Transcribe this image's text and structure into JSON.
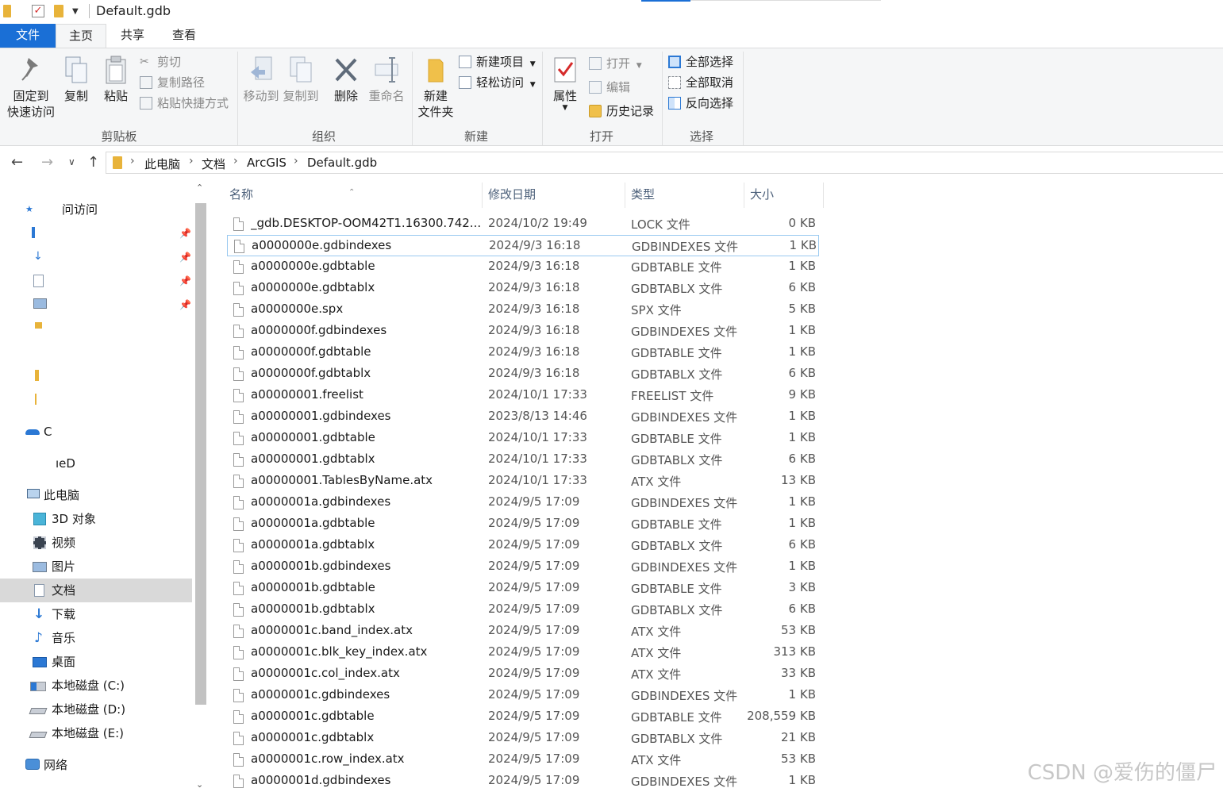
{
  "window": {
    "title": "Default.gdb"
  },
  "ribbon_tabs": {
    "file": "文件",
    "home": "主页",
    "share": "共享",
    "view": "查看"
  },
  "ribbon": {
    "clipboard": {
      "label": "剪贴板",
      "pin": "固定到\n快速访问",
      "pin_l1": "固定到",
      "pin_l2": "快速访问",
      "copy": "复制",
      "paste": "粘贴",
      "cut": "剪切",
      "copy_path": "复制路径",
      "paste_shortcut": "粘贴快捷方式"
    },
    "organize": {
      "label": "组织",
      "move_to": "移动到",
      "copy_to": "复制到",
      "delete": "删除",
      "rename": "重命名"
    },
    "new": {
      "label": "新建",
      "new_folder_l1": "新建",
      "new_folder_l2": "文件夹",
      "new_item": "新建项目",
      "easy_access": "轻松访问"
    },
    "open": {
      "label": "打开",
      "properties": "属性",
      "open": "打开",
      "edit": "编辑",
      "history": "历史记录"
    },
    "select": {
      "label": "选择",
      "select_all": "全部选择",
      "select_none": "全部取消",
      "invert": "反向选择"
    }
  },
  "breadcrumb": [
    "此电脑",
    "文档",
    "ArcGIS",
    "Default.gdb"
  ],
  "sidebar": {
    "quick_access": "问访问",
    "onedrive_c": "C",
    "onedrive_e": "ıeD",
    "this_pc": "此电脑",
    "items": [
      "3D 对象",
      "视频",
      "图片",
      "文档",
      "下载",
      "音乐",
      "桌面",
      "本地磁盘 (C:)",
      "本地磁盘 (D:)",
      "本地磁盘 (E:)"
    ],
    "network": "网络"
  },
  "columns": {
    "name": "名称",
    "date": "修改日期",
    "type": "类型",
    "size": "大小"
  },
  "files": [
    {
      "name": "_gdb.DESKTOP-OOM42T1.16300.742...",
      "date": "2024/10/2 19:49",
      "type": "LOCK 文件",
      "size": "0 KB"
    },
    {
      "name": "a0000000e.gdbindexes",
      "date": "2024/9/3 16:18",
      "type": "GDBINDEXES 文件",
      "size": "1 KB"
    },
    {
      "name": "a0000000e.gdbtable",
      "date": "2024/9/3 16:18",
      "type": "GDBTABLE 文件",
      "size": "1 KB"
    },
    {
      "name": "a0000000e.gdbtablx",
      "date": "2024/9/3 16:18",
      "type": "GDBTABLX 文件",
      "size": "6 KB"
    },
    {
      "name": "a0000000e.spx",
      "date": "2024/9/3 16:18",
      "type": "SPX 文件",
      "size": "5 KB"
    },
    {
      "name": "a0000000f.gdbindexes",
      "date": "2024/9/3 16:18",
      "type": "GDBINDEXES 文件",
      "size": "1 KB"
    },
    {
      "name": "a0000000f.gdbtable",
      "date": "2024/9/3 16:18",
      "type": "GDBTABLE 文件",
      "size": "1 KB"
    },
    {
      "name": "a0000000f.gdbtablx",
      "date": "2024/9/3 16:18",
      "type": "GDBTABLX 文件",
      "size": "6 KB"
    },
    {
      "name": "a00000001.freelist",
      "date": "2024/10/1 17:33",
      "type": "FREELIST 文件",
      "size": "9 KB"
    },
    {
      "name": "a00000001.gdbindexes",
      "date": "2023/8/13 14:46",
      "type": "GDBINDEXES 文件",
      "size": "1 KB"
    },
    {
      "name": "a00000001.gdbtable",
      "date": "2024/10/1 17:33",
      "type": "GDBTABLE 文件",
      "size": "1 KB"
    },
    {
      "name": "a00000001.gdbtablx",
      "date": "2024/10/1 17:33",
      "type": "GDBTABLX 文件",
      "size": "6 KB"
    },
    {
      "name": "a00000001.TablesByName.atx",
      "date": "2024/10/1 17:33",
      "type": "ATX 文件",
      "size": "13 KB"
    },
    {
      "name": "a0000001a.gdbindexes",
      "date": "2024/9/5 17:09",
      "type": "GDBINDEXES 文件",
      "size": "1 KB"
    },
    {
      "name": "a0000001a.gdbtable",
      "date": "2024/9/5 17:09",
      "type": "GDBTABLE 文件",
      "size": "1 KB"
    },
    {
      "name": "a0000001a.gdbtablx",
      "date": "2024/9/5 17:09",
      "type": "GDBTABLX 文件",
      "size": "6 KB"
    },
    {
      "name": "a0000001b.gdbindexes",
      "date": "2024/9/5 17:09",
      "type": "GDBINDEXES 文件",
      "size": "1 KB"
    },
    {
      "name": "a0000001b.gdbtable",
      "date": "2024/9/5 17:09",
      "type": "GDBTABLE 文件",
      "size": "3 KB"
    },
    {
      "name": "a0000001b.gdbtablx",
      "date": "2024/9/5 17:09",
      "type": "GDBTABLX 文件",
      "size": "6 KB"
    },
    {
      "name": "a0000001c.band_index.atx",
      "date": "2024/9/5 17:09",
      "type": "ATX 文件",
      "size": "53 KB"
    },
    {
      "name": "a0000001c.blk_key_index.atx",
      "date": "2024/9/5 17:09",
      "type": "ATX 文件",
      "size": "313 KB"
    },
    {
      "name": "a0000001c.col_index.atx",
      "date": "2024/9/5 17:09",
      "type": "ATX 文件",
      "size": "33 KB"
    },
    {
      "name": "a0000001c.gdbindexes",
      "date": "2024/9/5 17:09",
      "type": "GDBINDEXES 文件",
      "size": "1 KB"
    },
    {
      "name": "a0000001c.gdbtable",
      "date": "2024/9/5 17:09",
      "type": "GDBTABLE 文件",
      "size": "208,559 KB"
    },
    {
      "name": "a0000001c.gdbtablx",
      "date": "2024/9/5 17:09",
      "type": "GDBTABLX 文件",
      "size": "21 KB"
    },
    {
      "name": "a0000001c.row_index.atx",
      "date": "2024/9/5 17:09",
      "type": "ATX 文件",
      "size": "53 KB"
    },
    {
      "name": "a0000001d.gdbindexes",
      "date": "2024/9/5 17:09",
      "type": "GDBINDEXES 文件",
      "size": "1 KB"
    }
  ],
  "watermark": "CSDN @爱伤的僵尸",
  "colors": {
    "accent": "#1a6fd6",
    "folder": "#e8b33a",
    "selection": "#d9d9d9"
  }
}
